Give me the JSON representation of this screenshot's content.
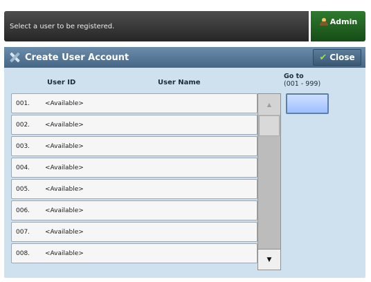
{
  "message_bar": {
    "text": "Select a user to be registered."
  },
  "admin_button": {
    "label": "Admin",
    "icon": "admin-user-icon"
  },
  "panel": {
    "title": "Create User Account",
    "title_icon": "tools-icon",
    "close_label": "Close",
    "close_icon": "checkmark-icon",
    "accent_color": "#4f7091"
  },
  "columns": {
    "user_id": "User ID",
    "user_name": "User Name"
  },
  "rows": [
    {
      "num": "001.",
      "value": "<Available>"
    },
    {
      "num": "002.",
      "value": "<Available>"
    },
    {
      "num": "003.",
      "value": "<Available>"
    },
    {
      "num": "004.",
      "value": "<Available>"
    },
    {
      "num": "005.",
      "value": "<Available>"
    },
    {
      "num": "006.",
      "value": "<Available>"
    },
    {
      "num": "007.",
      "value": "<Available>"
    },
    {
      "num": "008.",
      "value": "<Available>"
    }
  ],
  "scrollbar": {
    "up": "▲",
    "down": "▼"
  },
  "goto": {
    "label": "Go to",
    "range": "(001 - 999)",
    "value": ""
  }
}
